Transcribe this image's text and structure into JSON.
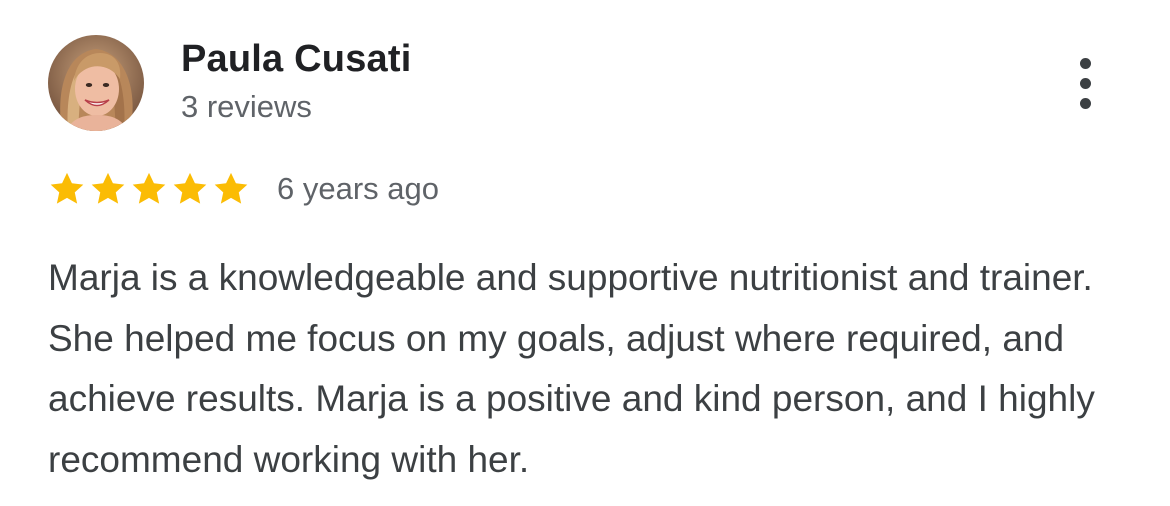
{
  "review": {
    "author": {
      "name": "Paula Cusati",
      "review_count": "3 reviews"
    },
    "rating": {
      "value": 5,
      "max": 5,
      "star_color": "#fbbc04"
    },
    "time": "6 years ago",
    "text": "Marja is a knowledgeable and supportive nutritionist and trainer. She helped me focus on my goals, adjust where required, and achieve results. Marja is a positive and kind person, and I highly recommend working with her."
  },
  "icons": {
    "more": "more-vert-icon",
    "star": "star-icon"
  }
}
